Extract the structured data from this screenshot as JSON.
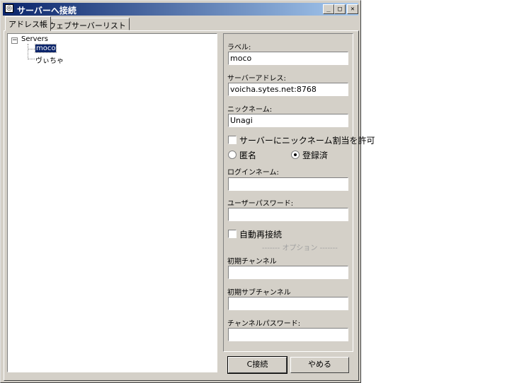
{
  "window": {
    "title": "サーバーへ接続",
    "controls": {
      "minimize": "_",
      "maximize": "□",
      "close": "✕"
    }
  },
  "tabs": [
    {
      "label": "アドレス帳",
      "active": true
    },
    {
      "label": "ウェブサーバーリスト",
      "active": false
    }
  ],
  "tree": {
    "expander": "−",
    "root": "Servers",
    "children": [
      {
        "label": "moco",
        "selected": true
      },
      {
        "label": "ヴぃちゃ",
        "selected": false
      }
    ]
  },
  "form": {
    "label_label": "ラベル:",
    "label_value": "moco",
    "address_label": "サーバーアドレス:",
    "address_value": "voicha.sytes.net:8768",
    "nickname_label": "ニックネーム:",
    "nickname_value": "Unagi",
    "allow_nick_label": "サーバーにニックネーム割当を許可",
    "allow_nick_checked": false,
    "anon_label": "匿名",
    "registered_label": "登録済",
    "selected_mode": "registered",
    "login_label": "ログインネーム:",
    "login_value": "",
    "password_label": "ユーザーパスワード:",
    "password_value": "",
    "autoreconnect_label": "自動再接続",
    "autoreconnect_checked": false,
    "options_separator": "------- オプション -------",
    "initial_channel_label": "初期チャンネル",
    "initial_channel_value": "",
    "initial_subchannel_label": "初期サブチャンネル",
    "initial_subchannel_value": "",
    "channel_password_label": "チャンネルパスワード:",
    "channel_password_value": ""
  },
  "buttons": {
    "connect": "C接続",
    "cancel": "やめる"
  },
  "colors": {
    "titlebar_start": "#0a246a",
    "titlebar_end": "#a6caf0",
    "face": "#d4d0c8",
    "selection": "#0a246a"
  }
}
